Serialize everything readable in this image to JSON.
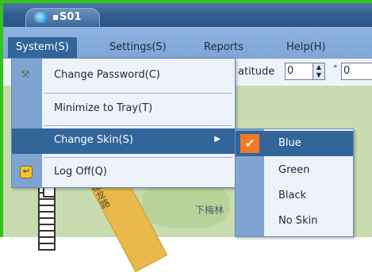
{
  "window": {
    "title_tab": "S01"
  },
  "menubar": {
    "items": [
      {
        "label": "System(S)"
      },
      {
        "label": "Settings(S)"
      },
      {
        "label": "Reports"
      },
      {
        "label": "Help(H)"
      }
    ]
  },
  "toolbar": {
    "latitude_label": "atitude",
    "latitude_value_1": "0",
    "latitude_value_2": "0",
    "degree_symbol": "°"
  },
  "system_menu": {
    "items": [
      {
        "label": "Change Password(C)",
        "icon": "key-icon"
      },
      {
        "label": "Minimize to Tray(T)"
      },
      {
        "label": "Change Skin(S)",
        "submenu_arrow": "▶"
      },
      {
        "label": "Log Off(Q)",
        "icon": "log-off-icon"
      }
    ]
  },
  "skin_submenu": {
    "items": [
      {
        "label": "Blue",
        "checked": true
      },
      {
        "label": "Green"
      },
      {
        "label": "Black"
      },
      {
        "label": "No Skin"
      }
    ]
  },
  "map": {
    "labels": {
      "place": "下梅林",
      "road": "福龙路"
    }
  },
  "colors": {
    "frame_green": "#33c41c",
    "menu_blue": "#7ea5d6",
    "highlight_blue": "#32659a",
    "check_orange": "#f07a24"
  }
}
